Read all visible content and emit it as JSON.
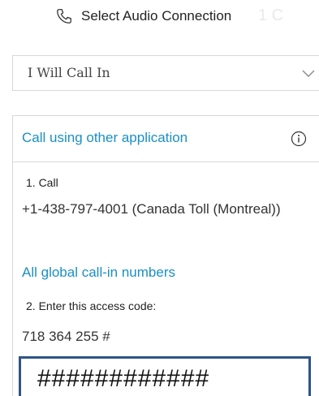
{
  "header": {
    "icon": "phone-icon",
    "title": "Select Audio Connection",
    "ghost_text": "1 C"
  },
  "audio_select": {
    "value": "I Will Call In",
    "icon": "chevron-down-icon"
  },
  "panel": {
    "title": "Call using other application",
    "info_icon": "info-icon",
    "step1_label": "1. Call",
    "phone_number": "+1-438-797-4001 (Canada Toll (Montreal))",
    "global_link": "All global call-in numbers",
    "step2_label": "2. Enter this access code:",
    "access_code": "718 364 255 #"
  },
  "overlay": {
    "text": "############"
  },
  "colors": {
    "link": "#1a8fc4",
    "border": "#d8d8d8",
    "overlay_border": "#2f5389"
  }
}
